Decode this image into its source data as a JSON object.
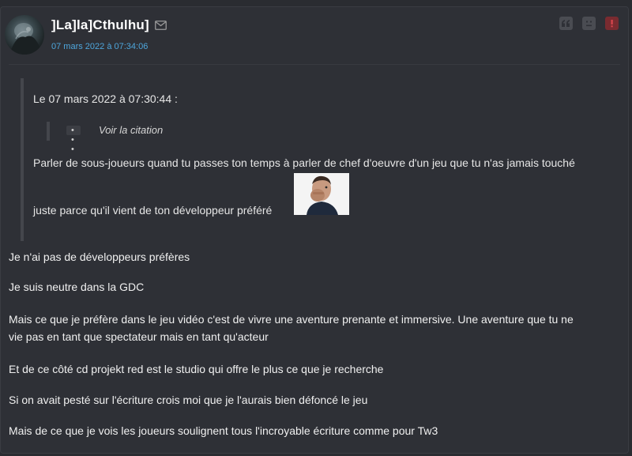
{
  "post": {
    "author": "]La]la]Cthulhu]",
    "date": "07 mars 2022 à 07:34:06",
    "actions": {
      "quote_icon": "quote-icon",
      "sad_icon": "sad-face-icon",
      "report_icon": "report-icon"
    },
    "quote": {
      "header": "Le 07 mars 2022 à 07:30:44 :",
      "nested_ellipsis": "• • •",
      "nested_label": "Voir la citation",
      "line1": "Parler de sous-joueurs quand tu passes ton temps à parler de chef d'oeuvre d'un jeu que tu n'as jamais touché",
      "line2": "juste parce qu'il vient de ton développeur préféré"
    },
    "body": [
      "Je n'ai pas de développeurs préfères",
      "Je suis neutre dans la GDC",
      "Mais ce que je préfère dans le jeu vidéo c'est de vivre une aventure prenante et immersive. Une aventure que tu ne",
      "vie pas en tant que spectateur mais en tant qu'acteur",
      "Et de ce côté cd projekt red est le studio qui offre le plus ce que je recherche",
      "Si on avait pesté sur l'écriture crois moi que je l'aurais bien défoncé le jeu",
      "Mais de ce que je vois les joueurs soulignent tous l'incroyable écriture comme pour Tw3"
    ],
    "colors": {
      "username": "#ffffff",
      "date": "#4ea6dc",
      "report": "#d9464e"
    }
  }
}
